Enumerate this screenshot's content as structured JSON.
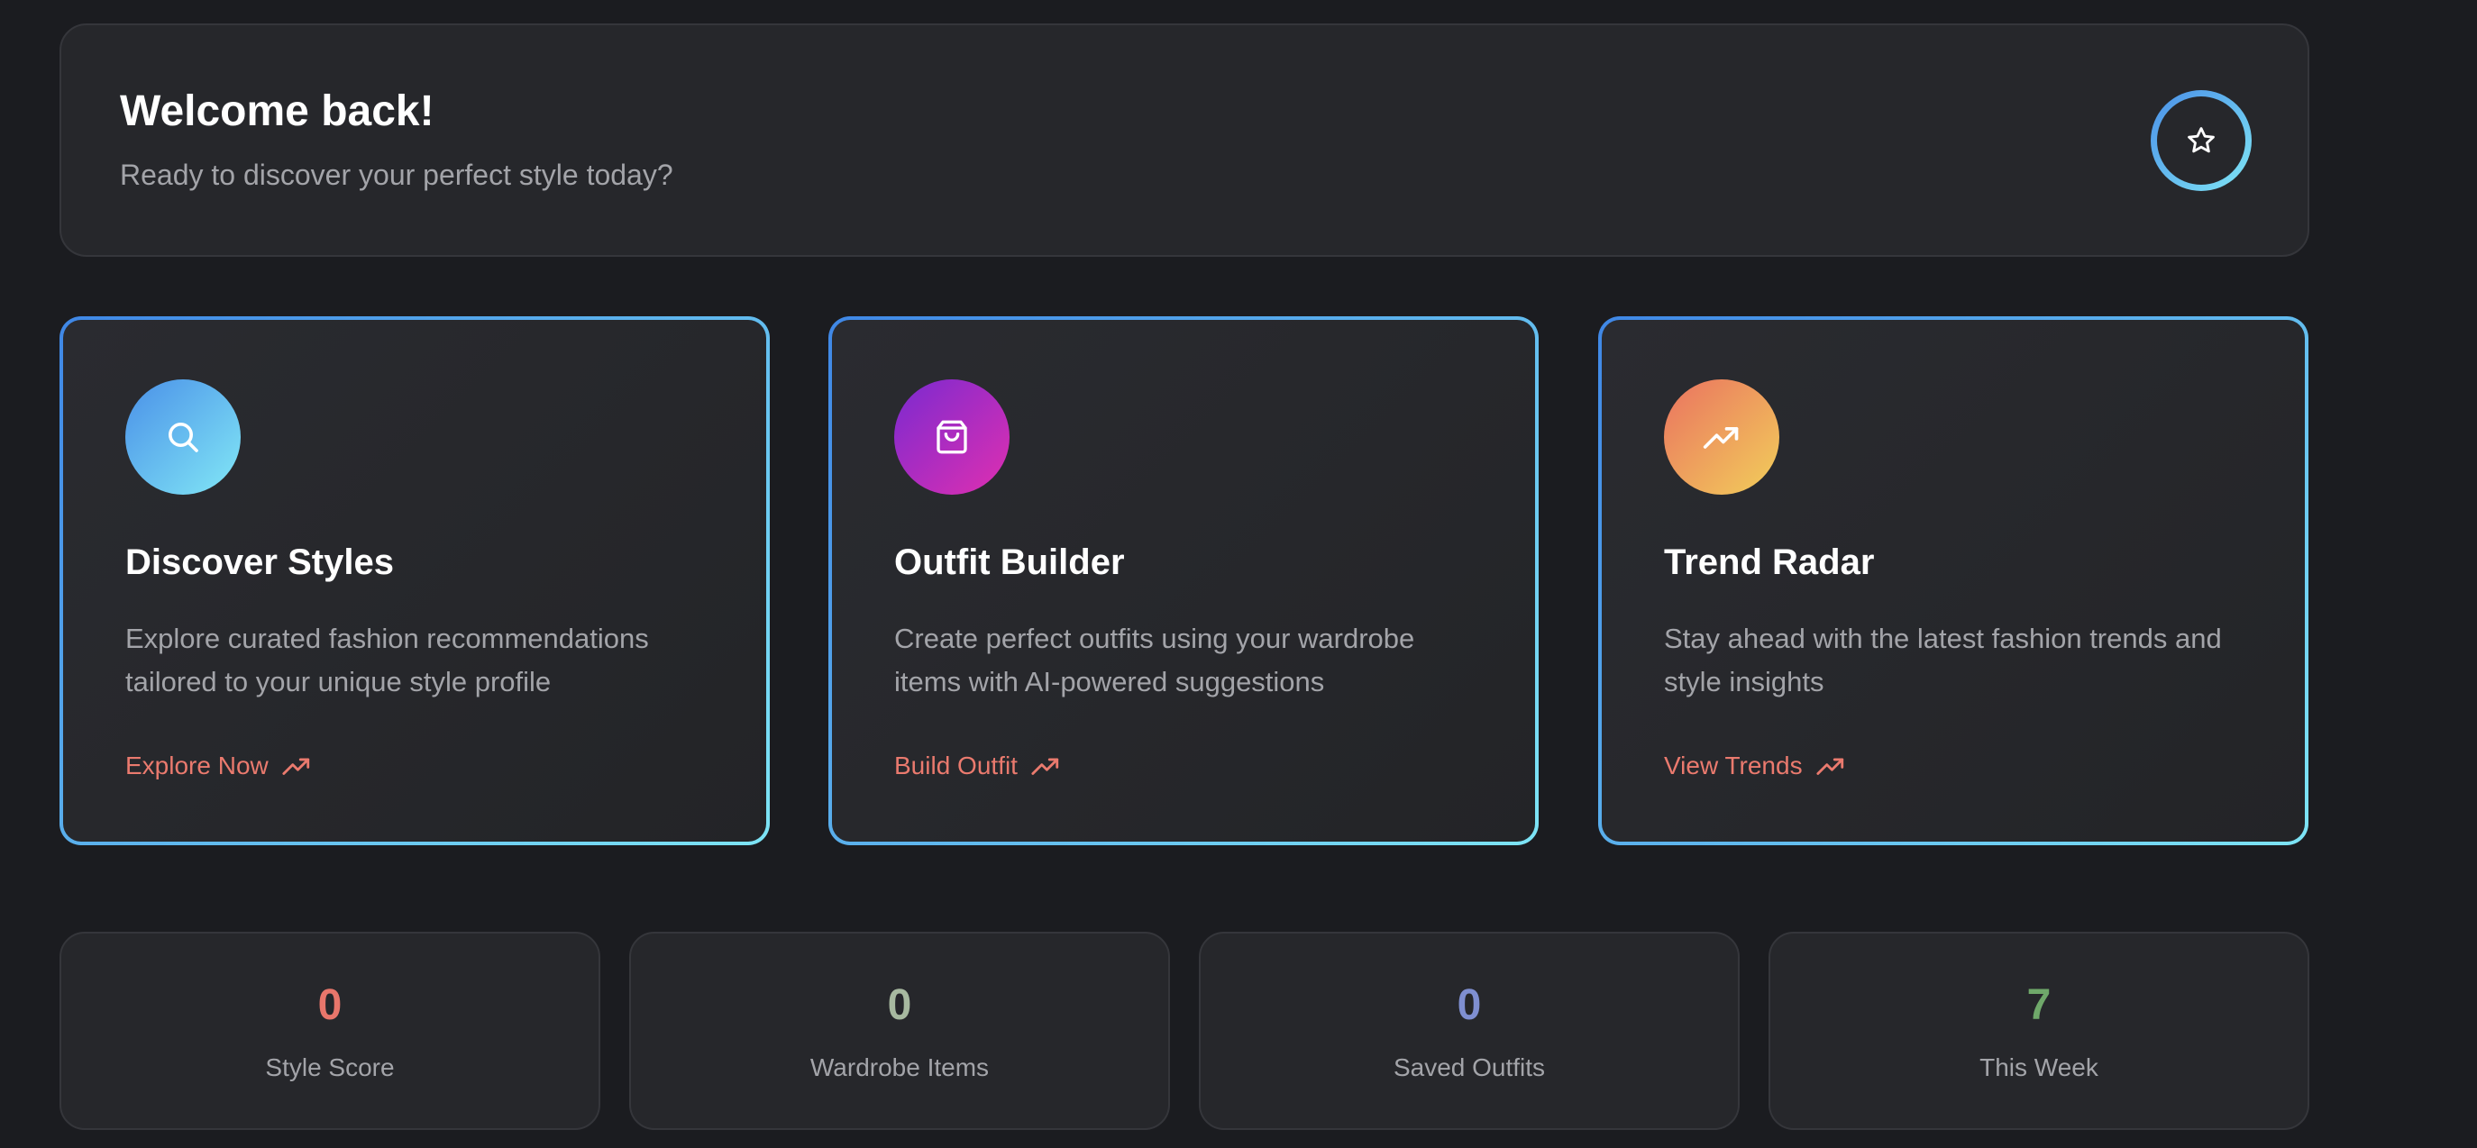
{
  "welcome": {
    "title": "Welcome back!",
    "subtitle": "Ready to discover your perfect style today?",
    "badge_icon": "star-icon"
  },
  "features": [
    {
      "icon": "search-icon",
      "title": "Discover Styles",
      "description": "Explore curated fashion recommendations tailored to your unique style profile",
      "link": "Explore Now",
      "link_icon": "trending-up-icon"
    },
    {
      "icon": "shopping-bag-icon",
      "title": "Outfit Builder",
      "description": "Create perfect outfits using your wardrobe items with AI-powered suggestions",
      "link": "Build Outfit",
      "link_icon": "trending-up-icon"
    },
    {
      "icon": "trending-up-icon",
      "title": "Trend Radar",
      "description": "Stay ahead with the latest fashion trends and style insights",
      "link": "View Trends",
      "link_icon": "trending-up-icon"
    }
  ],
  "stats": [
    {
      "value": "0",
      "label": "Style Score",
      "color": "#e8766b"
    },
    {
      "value": "0",
      "label": "Wardrobe Items",
      "color": "#a7b9a0"
    },
    {
      "value": "0",
      "label": "Saved Outfits",
      "color": "#7f8fd1"
    },
    {
      "value": "7",
      "label": "This Week",
      "color": "#6fa86a"
    }
  ],
  "colors": {
    "background": "#1b1c20",
    "card": "#26272b",
    "accent_link": "#ea7a6e",
    "border_gradient_start": "#3f87e6",
    "border_gradient_end": "#7de4f5"
  }
}
